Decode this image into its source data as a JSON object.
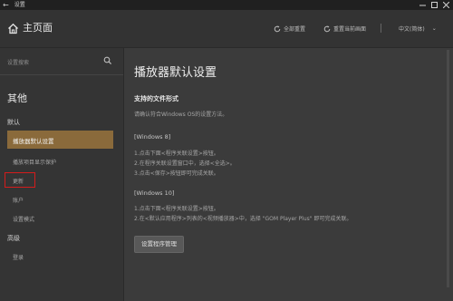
{
  "window": {
    "title": "设置"
  },
  "header": {
    "home_label": "主页面",
    "reset_all": "全部重置",
    "reset_current": "重置当前画面",
    "language": "中文(简体)"
  },
  "sidebar": {
    "search_placeholder": "设置搜索",
    "title": "其他",
    "sections": {
      "default": "默认",
      "advanced": "高级"
    },
    "items": [
      {
        "label": "播放器默认设置",
        "selected": true
      },
      {
        "label": "播放项目显示保护"
      },
      {
        "label": "更新",
        "highlighted": true
      },
      {
        "label": "账户"
      },
      {
        "label": "设置模式"
      },
      {
        "label": "登录"
      }
    ]
  },
  "main": {
    "title": "播放器默认设置",
    "section_title": "支持的文件形式",
    "intro": "请确认符合Windows OS的设置方法。",
    "win8": {
      "heading": "[Windows 8]",
      "steps": [
        "1.点击下面<程序关联设置>按钮。",
        "2.在程序关联设置窗口中，选择<全选>。",
        "3.点击<保存>按钮即可完成关联。"
      ]
    },
    "win10": {
      "heading": "[Windows 10]",
      "steps": [
        "1.点击下面<程序关联设置>按钮。",
        "2.在<默认应用程序>列表的<视频播放器>中，选择 \"GOM Player Plus\" 即可完成关联。"
      ]
    },
    "button": "设置程序管理"
  },
  "colors": {
    "selected_bg": "#8a6a3b",
    "highlight_border": "#d41c1c"
  }
}
